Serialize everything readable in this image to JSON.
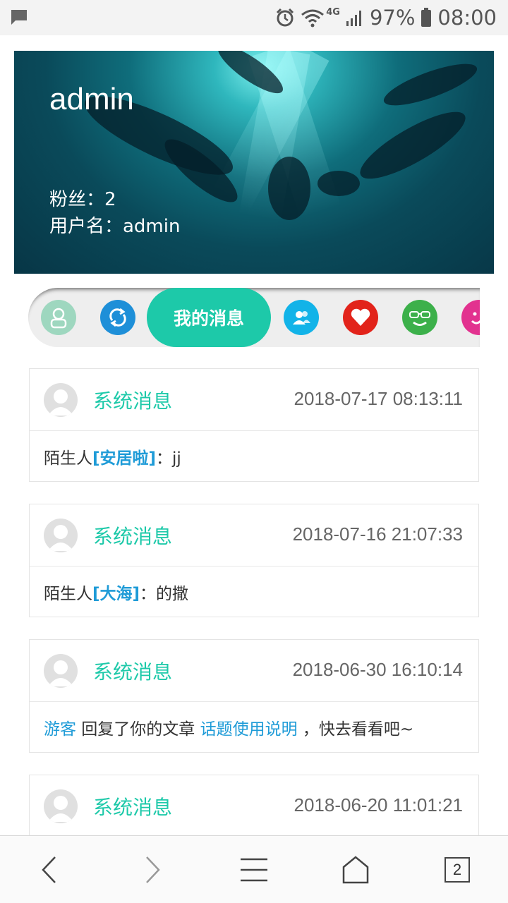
{
  "status_bar": {
    "notification_icon": "message-icon",
    "network": "4G",
    "battery": "97%",
    "time": "08:00"
  },
  "profile": {
    "title": "admin",
    "fans_line": "粉丝：2",
    "username_line": "用户名：admin"
  },
  "menu": {
    "active_label": "我的消息",
    "icons": [
      "user-icon",
      "refresh-icon",
      "contacts-icon",
      "heart-icon",
      "sunglasses-smiley-icon",
      "smiley-icon"
    ]
  },
  "messages": [
    {
      "sender": "系统消息",
      "time": "2018-07-17 08:13:11",
      "prefix": "陌生人",
      "name": "[安居啦]",
      "content": "：jj"
    },
    {
      "sender": "系统消息",
      "time": "2018-07-16 21:07:33",
      "prefix": "陌生人",
      "name": "[大海]",
      "content": "：的撒"
    },
    {
      "sender": "系统消息",
      "time": "2018-06-30 16:10:14",
      "actor": "游客",
      "action": " 回复了你的文章 ",
      "article": "话题使用说明",
      "suffix": " ，快去看看吧~"
    },
    {
      "sender": "系统消息",
      "time": "2018-06-20 11:01:21"
    }
  ],
  "browser_bar": {
    "tab_count": "2"
  },
  "colors": {
    "accent": "#1dc9a9",
    "link": "#1e9bd7"
  }
}
